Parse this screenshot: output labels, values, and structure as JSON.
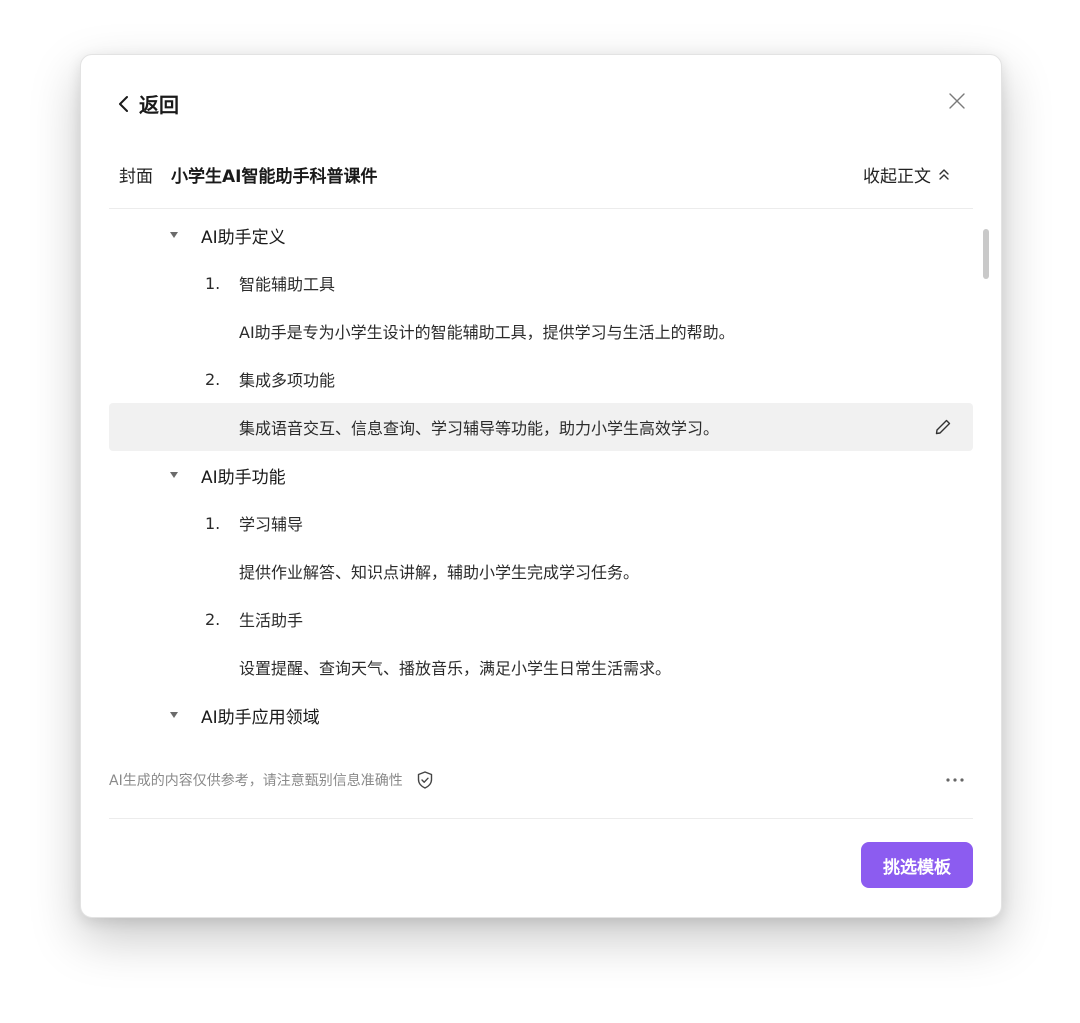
{
  "header": {
    "back_label": "返回",
    "cover_label": "封面",
    "deck_title": "小学生AI智能助手科普课件",
    "collapse_label": "收起正文"
  },
  "outline": {
    "sections": [
      {
        "title": "AI助手定义",
        "items": [
          {
            "number": "1.",
            "title": "智能辅助工具",
            "body": "AI助手是专为小学生设计的智能辅助工具，提供学习与生活上的帮助。"
          },
          {
            "number": "2.",
            "title": "集成多项功能",
            "body": "集成语音交互、信息查询、学习辅导等功能，助力小学生高效学习。"
          }
        ]
      },
      {
        "title": "AI助手功能",
        "items": [
          {
            "number": "1.",
            "title": "学习辅导",
            "body": "提供作业解答、知识点讲解，辅助小学生完成学习任务。"
          },
          {
            "number": "2.",
            "title": "生活助手",
            "body": "设置提醒、查询天气、播放音乐，满足小学生日常生活需求。"
          }
        ]
      },
      {
        "title": "AI助手应用领域",
        "items": []
      }
    ]
  },
  "footer": {
    "disclaimer": "AI生成的内容仅供参考，请注意甄别信息准确性",
    "primary_button": "挑选模板"
  },
  "colors": {
    "accent": "#8c5cf0",
    "hover_row": "#f1f1f1"
  },
  "icons": [
    "chevron-left-icon",
    "close-icon",
    "double-chevron-up-icon",
    "triangle-down-icon",
    "pencil-icon",
    "shield-check-icon",
    "more-horizontal-icon"
  ]
}
